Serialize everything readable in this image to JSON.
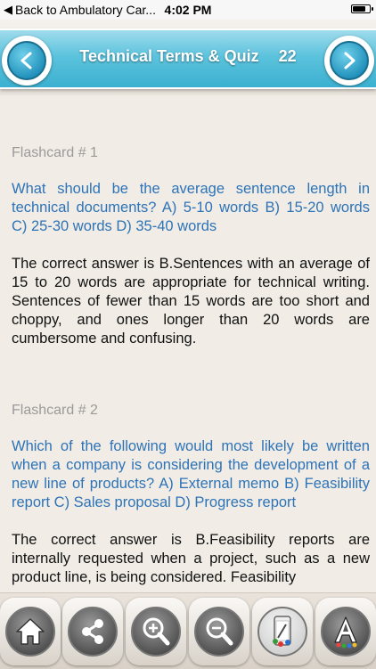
{
  "status_bar": {
    "back_label": "Back to Ambulatory Car...",
    "time": "4:02 PM",
    "battery_level": 0.8
  },
  "header": {
    "title": "Technical Terms & Quiz",
    "count": "22",
    "prev_icon": "chevron-left-icon",
    "next_icon": "chevron-right-icon"
  },
  "cards": [
    {
      "label": "Flashcard # 1",
      "question": "What should be the average sentence length in technical documents? A) 5-10 words B) 15-20 words C) 25-30 words D) 35-40 words",
      "answer": "The correct answer is B.Sentences with an average of 15 to 20 words are appropriate for technical writing. Sentences of fewer than 15 words are too short and choppy, and ones longer than 20 words are cumbersome and confusing."
    },
    {
      "label": "Flashcard # 2",
      "question": "Which of the following would most likely be written when a company is considering the development of a new line of products? A) External memo B) Feasibility report C) Sales proposal D) Progress report",
      "answer": "The correct answer is B.Feasibility reports are internally requested when a project, such as a new product line, is being considered. Feasibility"
    }
  ],
  "toolbar": {
    "buttons": [
      "home-icon",
      "share-icon",
      "zoom-in-icon",
      "zoom-out-icon",
      "theme-icon",
      "font-icon"
    ]
  },
  "colors": {
    "banner": "#3bb0d0",
    "question_text": "#2d73b7",
    "answer_text": "#111111",
    "label_text": "#9a9a9a",
    "background": "#f1ede6"
  }
}
